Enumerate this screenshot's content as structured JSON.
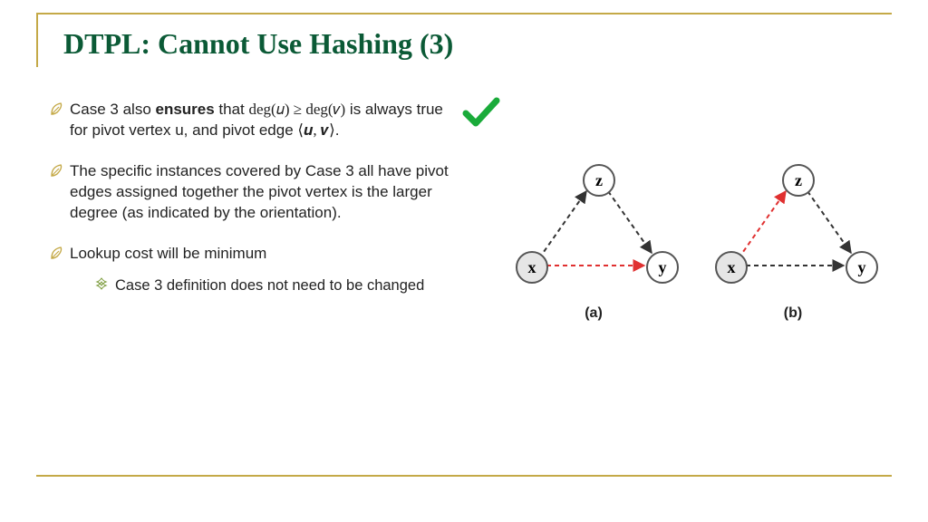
{
  "title": "DTPL: Cannot Use Hashing (3)",
  "bullets": {
    "b1_pre": "Case 3 also ",
    "b1_bold": "ensures",
    "b1_mid": " that ",
    "b1_math": "deg(𝑢) ≥ deg(𝑣)",
    "b1_post1": " is always true for pivot vertex u, and pivot edge ",
    "b1_math2": "⟨𝒖, 𝒗⟩",
    "b1_post2": ".",
    "b2": "The specific instances covered by Case 3 all have pivot edges assigned together the pivot vertex is the larger degree (as indicated by the orientation).",
    "b3": "Lookup cost will be minimum",
    "sub1": "Case 3 definition does not need to be changed"
  },
  "diagram": {
    "node_x": "x",
    "node_y": "y",
    "node_z": "z",
    "caption_a": "(a)",
    "caption_b": "(b)"
  }
}
